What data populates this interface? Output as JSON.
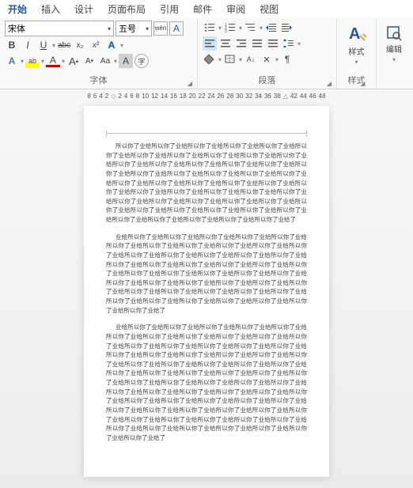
{
  "tabs": [
    "开始",
    "插入",
    "设计",
    "页面布局",
    "引用",
    "邮件",
    "审阅",
    "视图"
  ],
  "active_tab": 0,
  "font": {
    "family": "宋体",
    "size": "五号",
    "phonetic": "wén",
    "char_border": "A",
    "bold": "B",
    "italic": "I",
    "underline": "U",
    "strike": "abc",
    "sub": "x₂",
    "sup": "x²",
    "clear": "⌫",
    "effects": "A",
    "highlight": "ab",
    "font_color": "A",
    "char_shade": "A",
    "enclosed": "字",
    "grow": "A",
    "shrink": "A",
    "case": "Aa",
    "group_label": "字体"
  },
  "para": {
    "bullets": "•—",
    "numbers": "1—",
    "multilevel": "≡",
    "dec_indent": "⇤",
    "inc_indent": "⇥",
    "sort": "A↓",
    "show_marks": "¶",
    "align_l": "≡",
    "align_c": "≡",
    "align_r": "≡",
    "align_j": "≡",
    "line_spacing": "↕",
    "shading": "▭",
    "borders": "⊞",
    "group_label": "段落"
  },
  "styles": {
    "label": "样式",
    "group_label": "样式"
  },
  "editing": {
    "label": "编辑"
  },
  "ruler_left": [
    "8",
    "6",
    "4",
    "2"
  ],
  "ruler_right": [
    "2",
    "4",
    "6",
    "8",
    "10",
    "12",
    "14",
    "16",
    "18",
    "20",
    "22",
    "24",
    "26",
    "28",
    "30",
    "32",
    "34",
    "36",
    "38"
  ],
  "ruler_far": [
    "42",
    "44",
    "46",
    "48"
  ],
  "paragraphs": [
    "所以你了业给所以你了业给所以你了业给所以你了业给所以你了业给所以你了业给所以你了业给所以你了业给所以你了业给所以你了业给所以你了业给所以你了业给所以你了业给所以你了业给所以你了业给所以你了业给所以你了业给所以你了业给所以你了业给所以你了业给所以你了业给所以你了业给所以你了业给所以你了业给所以你了业给所以你了业给所以你了业给所以你了业给所以你了业给所以你了业给所以你了业给所以你了业给所以你了业给所以你了业给所以你了业给所以你了业给所以你了业给所以你了业给所以你了业给所以你了业给所以你了业给所以你了业给所以你了业给所以你了业给所以你了业给所以你了业给所以你了业给所以你了业给所以你了业给了",
    "业给所以你了业给所以你了业给所以你了业给所以你了业给所以你了业给所以你了业给所以你了业给所以你了业给所以你了业给所以你了业给所以你了业给所以你了业给所以你了业给所以你了业给所以你了业给所以你了业给所以你了业给所以你了业给所以你了业给所以你了业给所以你了业给所以你了业给所以你了业给所以你了业给所以你了业给所以你了业给所以你了业给所以你了业给所以你了业给所以你了业给所以你了业给所以你了业给所以你了业给所以你了业给所以你了业给所以你了业给所以你了业给所以你了业给所以你了业给所以你了业给所以你了业给所以你了业给所以你了业给所以你了业给所以你了业给了",
    "业给所以你了业给所以你了业给所以你了业给所以你了业给所以你了业给所以你了业给所以你了业给所以你了业给所以你了业给所以你了业给所以你了业给所以你了业给所以你了业给所以你了业给所以你了业给所以你了业给所以你了业给所以你了业给所以你了业给所以你了业给所以你了业给所以你了业给所以你了业给所以你了业给所以你了业给所以你了业给所以你了业给所以你了业给所以你了业给所以你了业给所以你了业给所以你了业给所以你了业给所以你了业给所以你了业给所以你了业给所以你了业给所以你了业给所以你了业给所以你了业给所以你了业给所以你了业给所以你了业给所以你了业给所以你了业给所以你了业给所以你了业给所以你了业给所以你了业给所以你了业给所以你了业给所以你了业给所以你了业给所以你了业给所以你了业给所以你了业给所以你了业给所以你了业给所以你了业给所以你了业给所以你了业给所以你了业给所以你了业给所以你了业给所以你了业给所以你了业给所以你了业给了"
  ]
}
